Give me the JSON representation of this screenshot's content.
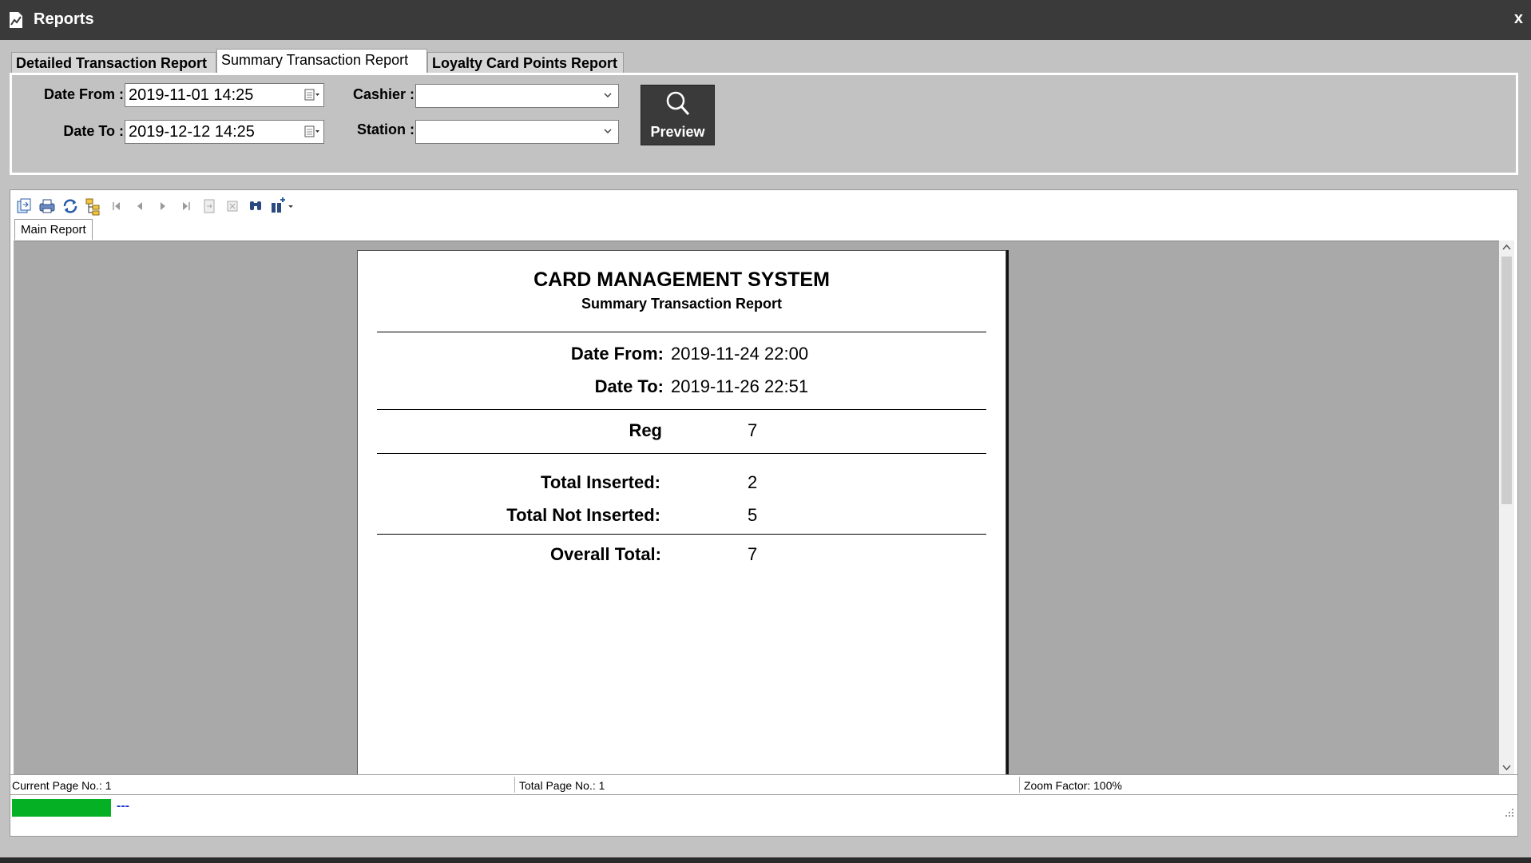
{
  "window": {
    "title": "Reports",
    "close_label": "x"
  },
  "tabs": [
    {
      "label": "Detailed Transaction Report",
      "active": false
    },
    {
      "label": "Summary Transaction Report",
      "active": true
    },
    {
      "label": "Loyalty Card Points Report",
      "active": false
    }
  ],
  "filters": {
    "date_from_label": "Date From :",
    "date_from_value": "2019-11-01 14:25",
    "date_to_label": "Date To :",
    "date_to_value": "2019-12-12 14:25",
    "cashier_label": "Cashier :",
    "cashier_value": "",
    "station_label": "Station :",
    "station_value": "",
    "preview_label": "Preview"
  },
  "viewer": {
    "toolbar_icons": [
      "export-icon",
      "print-icon",
      "refresh-icon",
      "group-tree-icon",
      "first-page-icon",
      "previous-page-icon",
      "next-page-icon",
      "last-page-icon",
      "go-to-page-icon",
      "stop-icon",
      "find-icon",
      "zoom-icon"
    ],
    "main_tab_label": "Main Report",
    "status": {
      "current_page": "Current Page No.: 1",
      "total_page": "Total Page No.: 1",
      "zoom": "Zoom Factor: 100%"
    },
    "progress": {
      "fraction": 1.0,
      "text": "---",
      "color": "#06b025"
    }
  },
  "report": {
    "title": "CARD MANAGEMENT SYSTEM",
    "subtitle": "Summary Transaction Report",
    "date_from_label": "Date From:",
    "date_from_value": "2019-11-24 22:00",
    "date_to_label": "Date To:",
    "date_to_value": "2019-11-26 22:51",
    "reg_label": "Reg",
    "reg_value": "7",
    "total_inserted_label": "Total Inserted:",
    "total_inserted_value": "2",
    "total_not_inserted_label": "Total Not Inserted:",
    "total_not_inserted_value": "5",
    "overall_total_label": "Overall Total:",
    "overall_total_value": "7"
  }
}
